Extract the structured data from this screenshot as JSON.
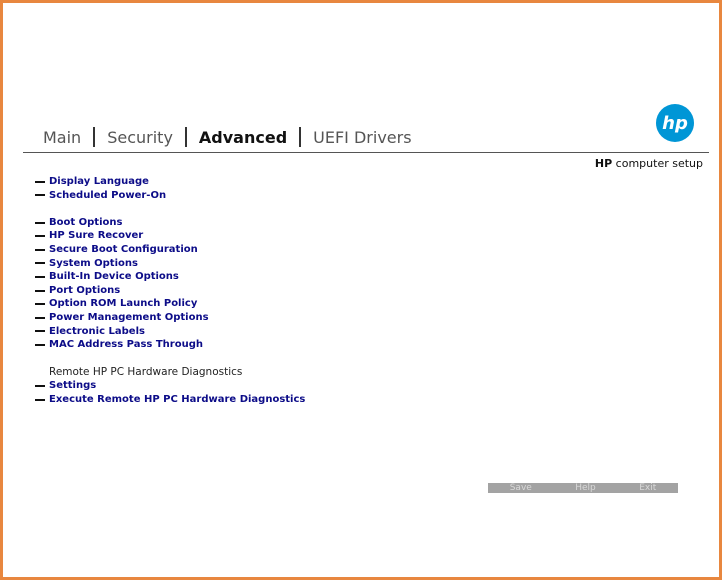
{
  "tabs": [
    "Main",
    "Security",
    "Advanced",
    "UEFI Drivers"
  ],
  "active_tab": "Advanced",
  "logo": {
    "text": "hp",
    "icon": "hp-logo-icon",
    "color": "#0096d6"
  },
  "brand": {
    "bold": "HP",
    "rest": " computer setup"
  },
  "menu": {
    "group1": [
      "Display Language",
      "Scheduled Power-On"
    ],
    "group2": [
      "Boot Options",
      "HP Sure Recover",
      "Secure Boot Configuration",
      "System Options",
      "Built-In Device Options",
      "Port Options",
      "Option ROM Launch Policy",
      "Power Management Options",
      "Electronic Labels",
      "MAC Address Pass Through"
    ],
    "diagnostics_heading": "Remote HP PC Hardware Diagnostics",
    "group3": [
      "Settings",
      "Execute Remote HP PC Hardware Diagnostics"
    ]
  },
  "bottom_bar": {
    "save": "Save",
    "help": "Help",
    "exit": "Exit"
  },
  "colors": {
    "border": "#e8873f",
    "menu_text": "#0c0c88",
    "bar": "#a3a3a3"
  }
}
